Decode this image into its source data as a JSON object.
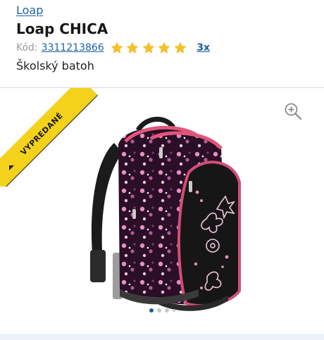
{
  "header": {
    "brand_link": "Loap",
    "title": "Loap CHICA",
    "code_label": "Kód:",
    "code_value": "3311213866",
    "rating": 5,
    "rating_max": 5,
    "reviews_count": "3x",
    "subtitle": "Školský batoh"
  },
  "gallery": {
    "badge": "VYPREDANÉ",
    "badge_color": "#f4d21c",
    "zoom_icon": "zoom-in-icon",
    "image_subject": "backpack",
    "slide_count": 4,
    "active_slide": 1
  },
  "colors": {
    "link": "#1d5fa8",
    "star": "#f2c12e",
    "active_dot": "#1d5fa8"
  }
}
